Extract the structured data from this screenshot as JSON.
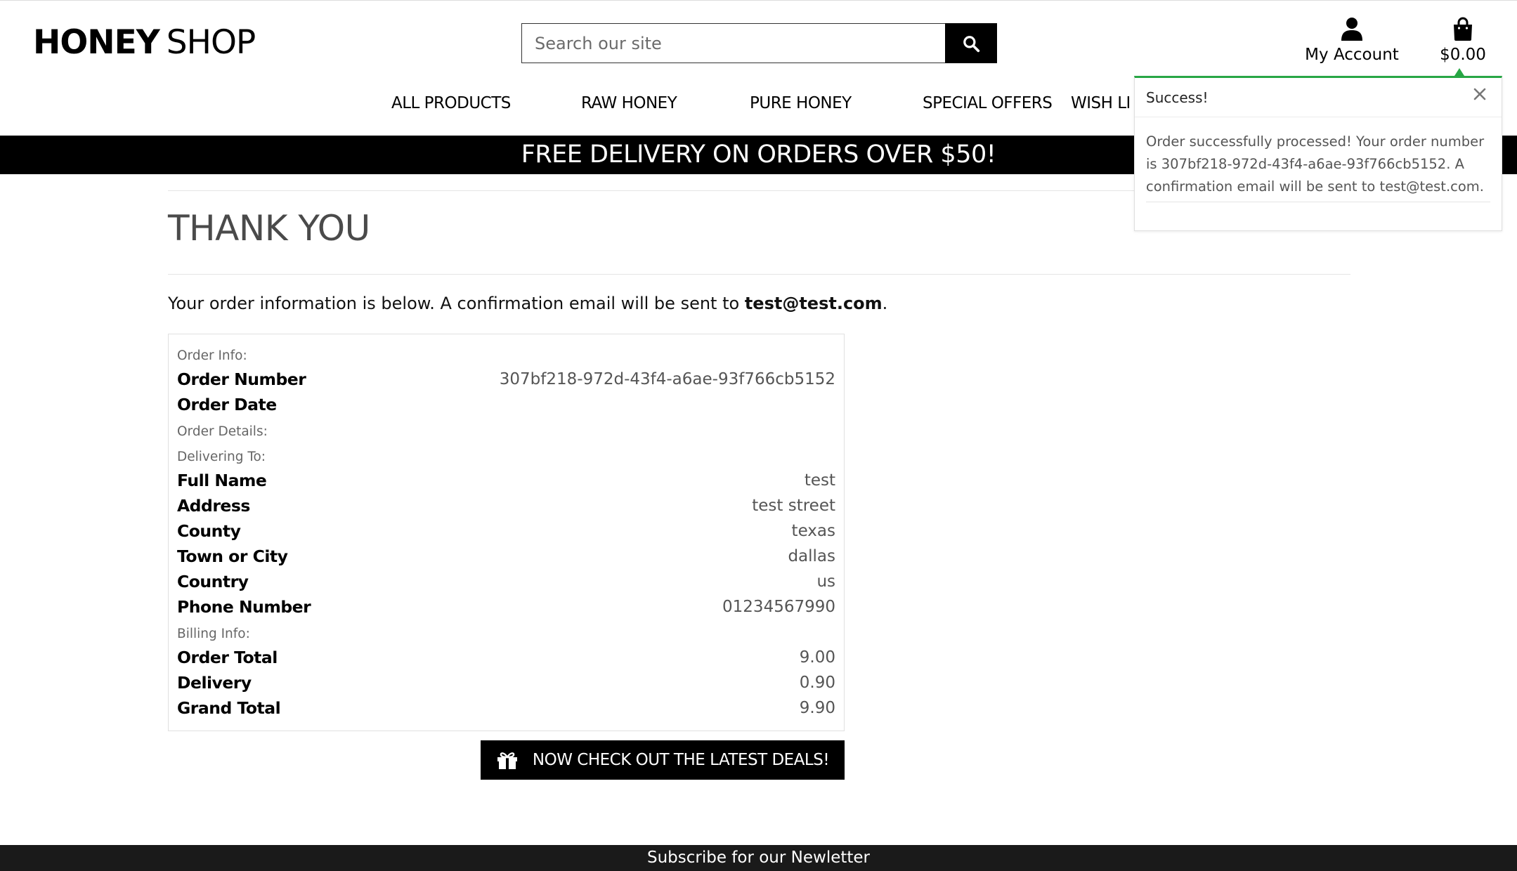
{
  "header": {
    "logo_bold": "HONEY",
    "logo_light": "SHOP",
    "search_placeholder": "Search our site",
    "account_label": "My Account",
    "bag_total": "$0.00"
  },
  "nav": {
    "items": [
      "ALL PRODUCTS",
      "RAW HONEY",
      "PURE HONEY",
      "SPECIAL OFFERS",
      "WISH LI"
    ]
  },
  "banner": "FREE DELIVERY ON ORDERS OVER $50!",
  "page": {
    "title": "THANK YOU",
    "intro_text": "Your order information is below. A confirmation email will be sent to ",
    "intro_email": "test@test.com",
    "intro_end": "."
  },
  "order": {
    "order_info_label": "Order Info:",
    "order_number_label": "Order Number",
    "order_number": "307bf218-972d-43f4-a6ae-93f766cb5152",
    "order_date_label": "Order Date",
    "order_date": "",
    "order_details_label": "Order Details:",
    "delivering_to_label": "Delivering To:",
    "full_name_label": "Full Name",
    "full_name": "test",
    "address_label": "Address",
    "address": "test street",
    "county_label": "County",
    "county": "texas",
    "town_label": "Town or City",
    "town": "dallas",
    "country_label": "Country",
    "country": "us",
    "phone_label": "Phone Number",
    "phone": "01234567990",
    "billing_info_label": "Billing Info:",
    "order_total_label": "Order Total",
    "order_total": "9.00",
    "delivery_label": "Delivery",
    "delivery": "0.90",
    "grand_total_label": "Grand Total",
    "grand_total": "9.90"
  },
  "deals_button": "NOW CHECK OUT THE LATEST DEALS!",
  "footer": "Subscribe for our Newletter",
  "toast": {
    "title": "Success!",
    "message": "Order successfully processed! Your order number is 307bf218-972d-43f4-a6ae-93f766cb5152. A confirmation email will be sent to test@test.com.",
    "accent_color": "#28a745"
  },
  "icons": {
    "search": "search-icon",
    "account": "user-icon",
    "bag": "shopping-bag-icon",
    "close": "close-icon",
    "gift": "gift-icon"
  }
}
